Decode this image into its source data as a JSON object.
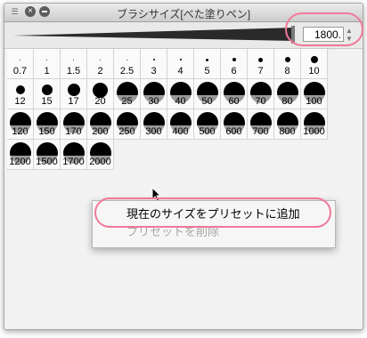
{
  "window": {
    "title": "ブラシサイズ[べた塗りペン]"
  },
  "size_field": {
    "value": "1800."
  },
  "presets": [
    {
      "label": "0.7",
      "dot": 1
    },
    {
      "label": "1",
      "dot": 1
    },
    {
      "label": "1.5",
      "dot": 1
    },
    {
      "label": "2",
      "dot": 1
    },
    {
      "label": "2.5",
      "dot": 1
    },
    {
      "label": "3",
      "dot": 2
    },
    {
      "label": "4",
      "dot": 2
    },
    {
      "label": "5",
      "dot": 3
    },
    {
      "label": "6",
      "dot": 4
    },
    {
      "label": "7",
      "dot": 5
    },
    {
      "label": "8",
      "dot": 6
    },
    {
      "label": "10",
      "dot": 8
    },
    {
      "label": "12",
      "dot": 10
    },
    {
      "label": "15",
      "dot": 12
    },
    {
      "label": "17",
      "dot": 14
    },
    {
      "label": "20",
      "dot": 17
    },
    {
      "label": "25",
      "dot": 0
    },
    {
      "label": "30",
      "dot": 0
    },
    {
      "label": "40",
      "dot": 0
    },
    {
      "label": "50",
      "dot": 0
    },
    {
      "label": "60",
      "dot": 0
    },
    {
      "label": "70",
      "dot": 0
    },
    {
      "label": "80",
      "dot": 0
    },
    {
      "label": "100",
      "dot": 0
    },
    {
      "label": "120",
      "dot": 0
    },
    {
      "label": "150",
      "dot": 0
    },
    {
      "label": "170",
      "dot": 0
    },
    {
      "label": "200",
      "dot": 0
    },
    {
      "label": "250",
      "dot": 0
    },
    {
      "label": "300",
      "dot": 0
    },
    {
      "label": "400",
      "dot": 0
    },
    {
      "label": "500",
      "dot": 0
    },
    {
      "label": "600",
      "dot": 0
    },
    {
      "label": "700",
      "dot": 0
    },
    {
      "label": "800",
      "dot": 0
    },
    {
      "label": "1000",
      "dot": 0
    },
    {
      "label": "1200",
      "dot": 0
    },
    {
      "label": "1500",
      "dot": 0
    },
    {
      "label": "1700",
      "dot": 0
    },
    {
      "label": "2000",
      "dot": 0
    }
  ],
  "context_menu": {
    "add_preset": "現在のサイズをプリセットに追加",
    "delete_preset": "プリセットを削除"
  },
  "colors": {
    "highlight": "#f07898"
  }
}
